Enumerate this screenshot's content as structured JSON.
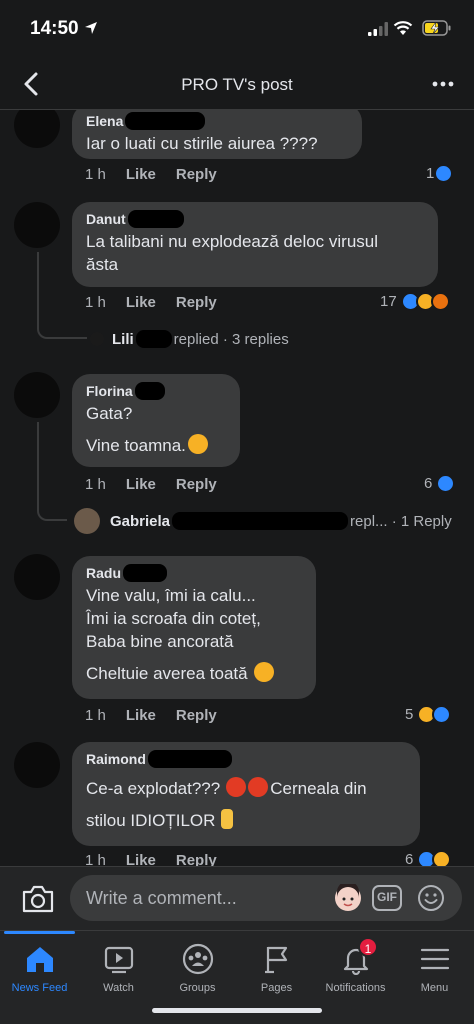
{
  "status_bar": {
    "time": "14:50"
  },
  "header": {
    "title": "PRO TV's post"
  },
  "comments": [
    {
      "author": "Elena",
      "lines": [
        "Iar o luati cu stirile aiurea ????"
      ],
      "time": "1 h",
      "like": "Like",
      "reply": "Reply",
      "reaction_count": "1"
    },
    {
      "author": "Danut",
      "lines": [
        "La talibani nu explodează deloc virusul",
        "ăsta"
      ],
      "time": "1 h",
      "like": "Like",
      "reply": "Reply",
      "reaction_count": "17",
      "replies": {
        "name": "Lili",
        "text": "replied · 3 replies"
      }
    },
    {
      "author": "Florina",
      "lines": [
        "Gata?",
        "Vine toamna."
      ],
      "time": "1 h",
      "like": "Like",
      "reply": "Reply",
      "reaction_count": "6",
      "replies": {
        "name": "Gabriela",
        "text": "repl... · 1 Reply"
      }
    },
    {
      "author": "Radu",
      "lines": [
        "Vine valu, îmi ia calu...",
        "Îmi ia scroafa din coteț,",
        "Baba bine ancorată",
        "Cheltuie averea toată"
      ],
      "time": "1 h",
      "like": "Like",
      "reply": "Reply",
      "reaction_count": "5"
    },
    {
      "author": "Raimond",
      "lines": [
        "Ce-a explodat???",
        "Cerneala din",
        "stilou IDIOȚILOR"
      ],
      "time": "1 h",
      "like": "Like",
      "reply": "Reply",
      "reaction_count": "6"
    }
  ],
  "composer": {
    "placeholder": "Write a comment...",
    "gif_label": "GIF"
  },
  "tabs": [
    {
      "label": "News Feed",
      "icon": "home-icon",
      "active": true
    },
    {
      "label": "Watch",
      "icon": "watch-icon"
    },
    {
      "label": "Groups",
      "icon": "groups-icon"
    },
    {
      "label": "Pages",
      "icon": "pages-flag-icon"
    },
    {
      "label": "Notifications",
      "icon": "bell-icon",
      "badge": "1"
    },
    {
      "label": "Menu",
      "icon": "hamburger-icon"
    }
  ],
  "colors": {
    "background": "#18191a",
    "bubble": "#3a3b3c",
    "accent": "#2d88ff",
    "badge": "#e41e3f"
  }
}
